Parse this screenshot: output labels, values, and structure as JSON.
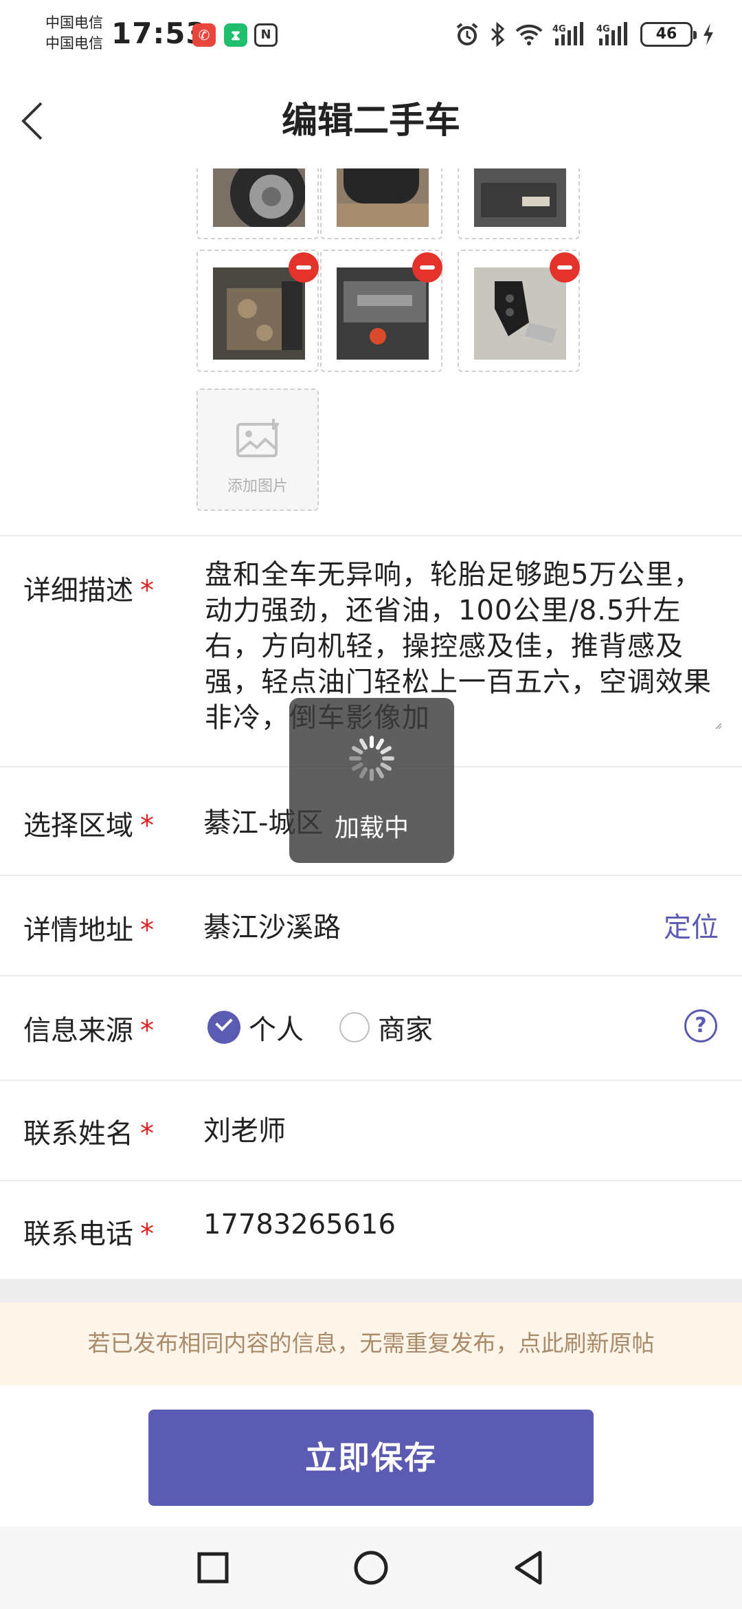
{
  "status_bar": {
    "carrier1": "中国电信",
    "carrier2": "中国电信",
    "time": "17:53",
    "battery": "46"
  },
  "header": {
    "title": "编辑二手车"
  },
  "photos": {
    "add_label": "添加图片"
  },
  "form": {
    "description": {
      "label": "详细描述",
      "value": "盘和全车无异响，轮胎足够跑5万公里，动力强劲，还省油，100公里/8.5升左右，方向机轻，操控感及佳，推背感及强，轻点油门轻松上一百五六，空调效果非冷，倒车影像加"
    },
    "region": {
      "label": "选择区域",
      "value": "綦江-城区"
    },
    "address": {
      "label": "详情地址",
      "value": "綦江沙溪路",
      "action": "定位"
    },
    "source": {
      "label": "信息来源",
      "options": [
        {
          "label": "个人",
          "checked": true
        },
        {
          "label": "商家",
          "checked": false
        }
      ],
      "help": "?"
    },
    "contact_name": {
      "label": "联系姓名",
      "value": "刘老师"
    },
    "contact_phone": {
      "label": "联系电话",
      "value": "17783265616"
    },
    "required_mark": "*"
  },
  "notice": "若已发布相同内容的信息，无需重复发布，点此刷新原帖",
  "save_button": "立即保存",
  "loading": "加载中",
  "colors": {
    "accent": "#5b5bb3",
    "required": "#e02020",
    "notice_bg": "#fdf4ea",
    "notice_text": "#a98a69",
    "remove": "#e4332a"
  }
}
